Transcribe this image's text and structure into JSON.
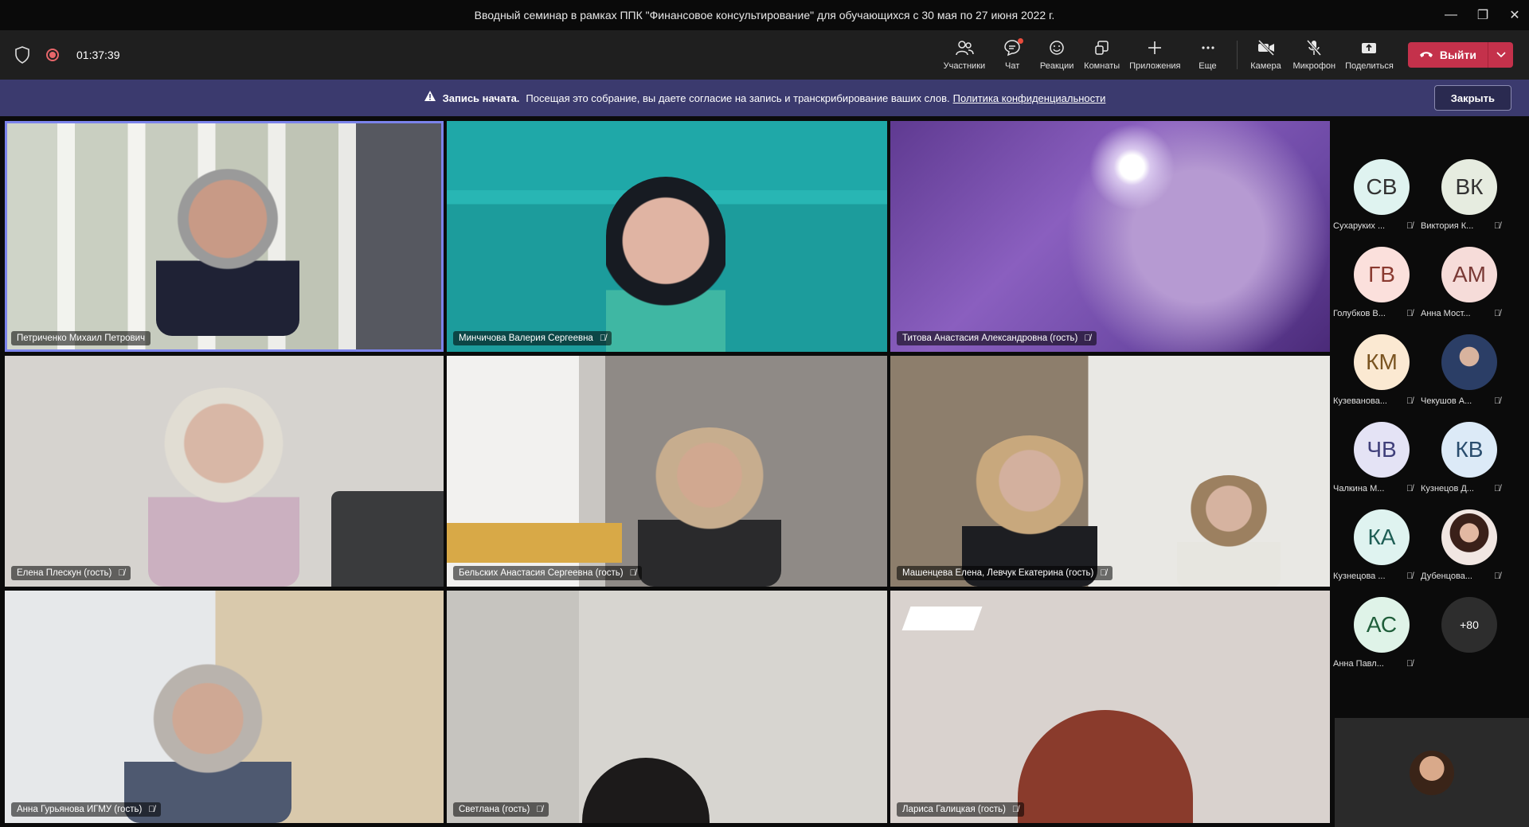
{
  "window": {
    "title": "Вводный семинар в рамках ППК \"Финансовое консультирование\" для обучающихся с 30 мая по 27 июня 2022 г.",
    "minimize": "—",
    "maximize": "❐",
    "close": "✕"
  },
  "meeting": {
    "timer": "01:37:39"
  },
  "toolbar": {
    "participants": "Участники",
    "chat": "Чат",
    "reactions": "Реакции",
    "rooms": "Комнаты",
    "apps": "Приложения",
    "more": "Еще",
    "camera": "Камера",
    "mic": "Микрофон",
    "share": "Поделиться",
    "leave": "Выйти"
  },
  "banner": {
    "title": "Запись начата.",
    "text": "Посещая это собрание, вы даете согласие на запись и транскрибирование ваших слов.",
    "link": "Политика конфиденциальности",
    "close": "Закрыть"
  },
  "tiles": [
    {
      "name": "Петриченко Михаил Петрович",
      "muted": false,
      "active": true
    },
    {
      "name": "Минчичова Валерия Сергеевна",
      "muted": true
    },
    {
      "name": "Титова Анастасия Александровна (гость)",
      "muted": true
    },
    {
      "name": "Елена Плескун (гость)",
      "muted": true
    },
    {
      "name": "Бельских Анастасия Сергеевна (гость)",
      "muted": true
    },
    {
      "name": "Машенцева Елена, Левчук Екатерина (гость)",
      "muted": true
    },
    {
      "name": "Анна Гурьянова ИГМУ (гость)",
      "muted": true
    },
    {
      "name": "Светлана (гость)",
      "muted": true
    },
    {
      "name": "Лариса Галицкая (гость)",
      "muted": true
    }
  ],
  "participants": [
    {
      "initials": "СВ",
      "name": "Сухаруких ...",
      "color": "#dff3f0"
    },
    {
      "initials": "ВК",
      "name": "Виктория К...",
      "color": "#e6ece0"
    },
    {
      "initials": "ГВ",
      "name": "Голубков В...",
      "color": "#fbe0dc"
    },
    {
      "initials": "АМ",
      "name": "Анна Мост...",
      "color": "#f6dcd9"
    },
    {
      "initials": "КМ",
      "name": "Кузеванова...",
      "color": "#fbe9d2"
    },
    {
      "initials": "",
      "name": "Чекушов А...",
      "color": "#3b5b86"
    },
    {
      "initials": "ЧВ",
      "name": "Чалкина М...",
      "color": "#e4e3f5"
    },
    {
      "initials": "КВ",
      "name": "Кузнецов Д...",
      "color": "#dceaf7"
    },
    {
      "initials": "КА",
      "name": "Кузнецова ...",
      "color": "#dff3f0"
    },
    {
      "initials": "",
      "name": "Дубенцова...",
      "color": "#e9c7b5"
    },
    {
      "initials": "АС",
      "name": "Анна Павл...",
      "color": "#dff3e8"
    }
  ],
  "more_count": "+80"
}
